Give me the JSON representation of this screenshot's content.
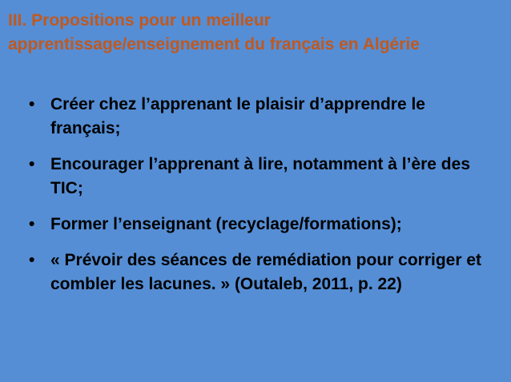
{
  "slide": {
    "title": "III. Propositions pour un meilleur apprentissage/enseignement du français en Algérie",
    "bullet_symbol": "•",
    "bullets": [
      "Créer chez l’apprenant le plaisir d’apprendre le français;",
      "Encourager l’apprenant à lire, notamment à l’ère des TIC;",
      "Former l’enseignant (recyclage/formations);",
      "« Prévoir des séances de remédiation pour corriger et combler les lacunes. » (Outaleb, 2011, p. 22)"
    ]
  },
  "colors": {
    "background": "#558ed5",
    "title": "#c0591f",
    "body_text": "#000000"
  }
}
